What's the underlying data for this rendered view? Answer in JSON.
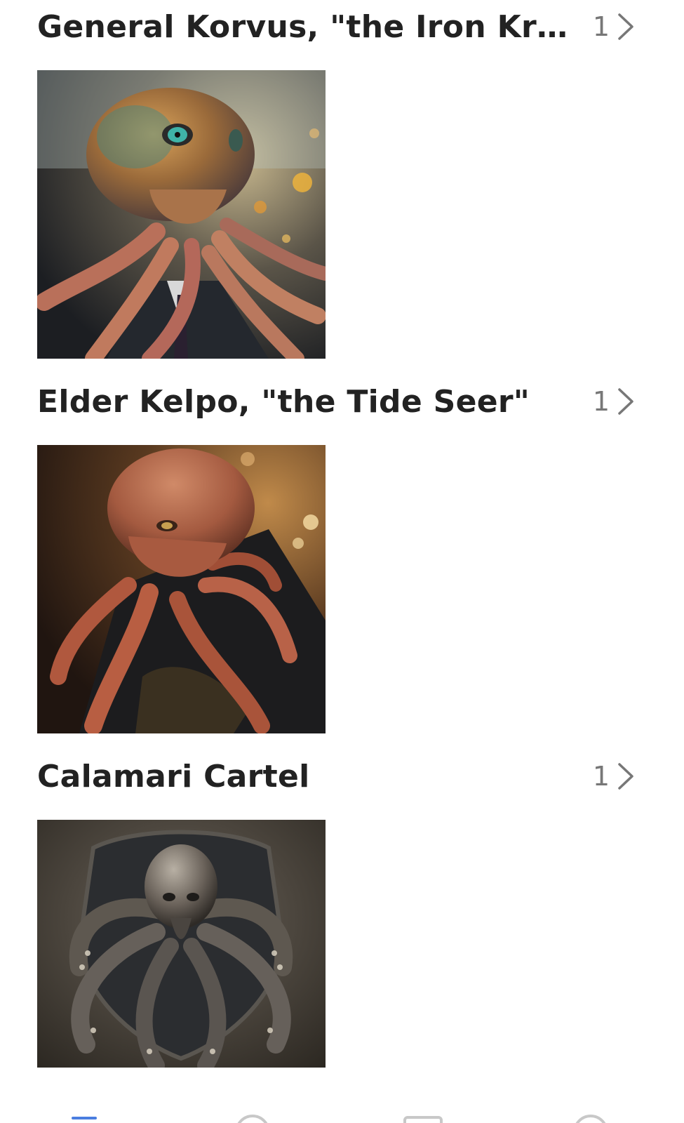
{
  "collections": [
    {
      "title": "General Korvus, \"the Iron Kraken\"",
      "count": "1",
      "image_icon": "octopus-image",
      "accent": "#b0703a"
    },
    {
      "title": "Elder Kelpo, \"the Tide Seer\"",
      "count": "1",
      "image_icon": "octopus-image",
      "accent": "#b55a3e"
    },
    {
      "title": "Calamari Cartel",
      "count": "1",
      "image_icon": "octopus-emblem-image",
      "accent": "#6a625a"
    }
  ],
  "bottom_nav": {
    "items": [
      "home-tab",
      "search-tab",
      "library-tab",
      "profile-tab"
    ],
    "active_color": "#4a7ee0"
  }
}
